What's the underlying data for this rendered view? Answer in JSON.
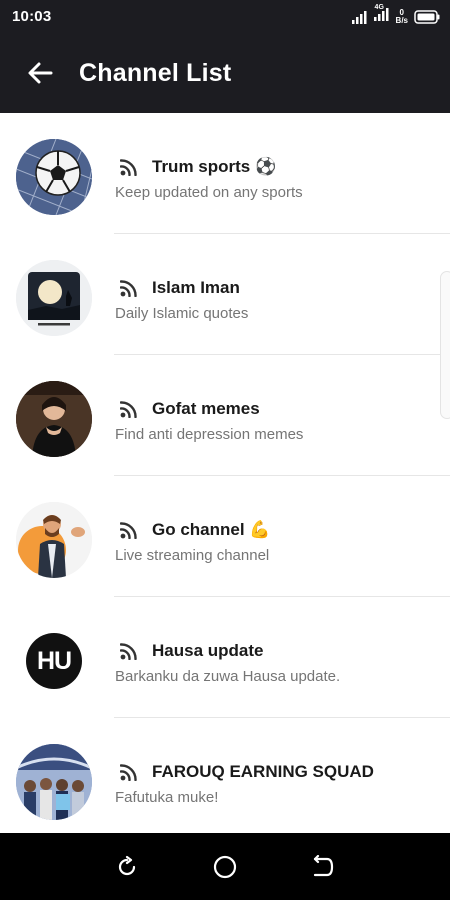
{
  "status_bar": {
    "time": "10:03",
    "network_type": "4G",
    "speed_value": "0",
    "speed_unit": "B/s"
  },
  "app_bar": {
    "title": "Channel List",
    "back_icon": "arrow-left-icon"
  },
  "channels": [
    {
      "name": "Trum sports ⚽",
      "description": "Keep updated on any sports",
      "icon": "rss-icon"
    },
    {
      "name": "Islam Iman",
      "description": "Daily Islamic quotes",
      "icon": "rss-icon"
    },
    {
      "name": "Gofat memes",
      "description": "Find anti depression memes",
      "icon": "rss-icon"
    },
    {
      "name": "Go channel 💪",
      "description": "Live streaming channel",
      "icon": "rss-icon"
    },
    {
      "name": "Hausa update",
      "description": "Barkanku da zuwa Hausa update.",
      "icon": "rss-icon"
    },
    {
      "name": "FAROUQ EARNING SQUAD",
      "description": "Fafutuka muke!",
      "icon": "rss-icon"
    }
  ],
  "avatar_texts": {
    "hausa_logo": "HU"
  },
  "navigation": {
    "buttons": [
      "recent-apps-icon",
      "home-icon",
      "back-icon"
    ]
  },
  "colors": {
    "app_bar_bg": "#1c1c21",
    "title_text": "#ffffff",
    "name_text": "#1a1a1a",
    "desc_text": "#757575",
    "nav_bar_bg": "#000000"
  }
}
